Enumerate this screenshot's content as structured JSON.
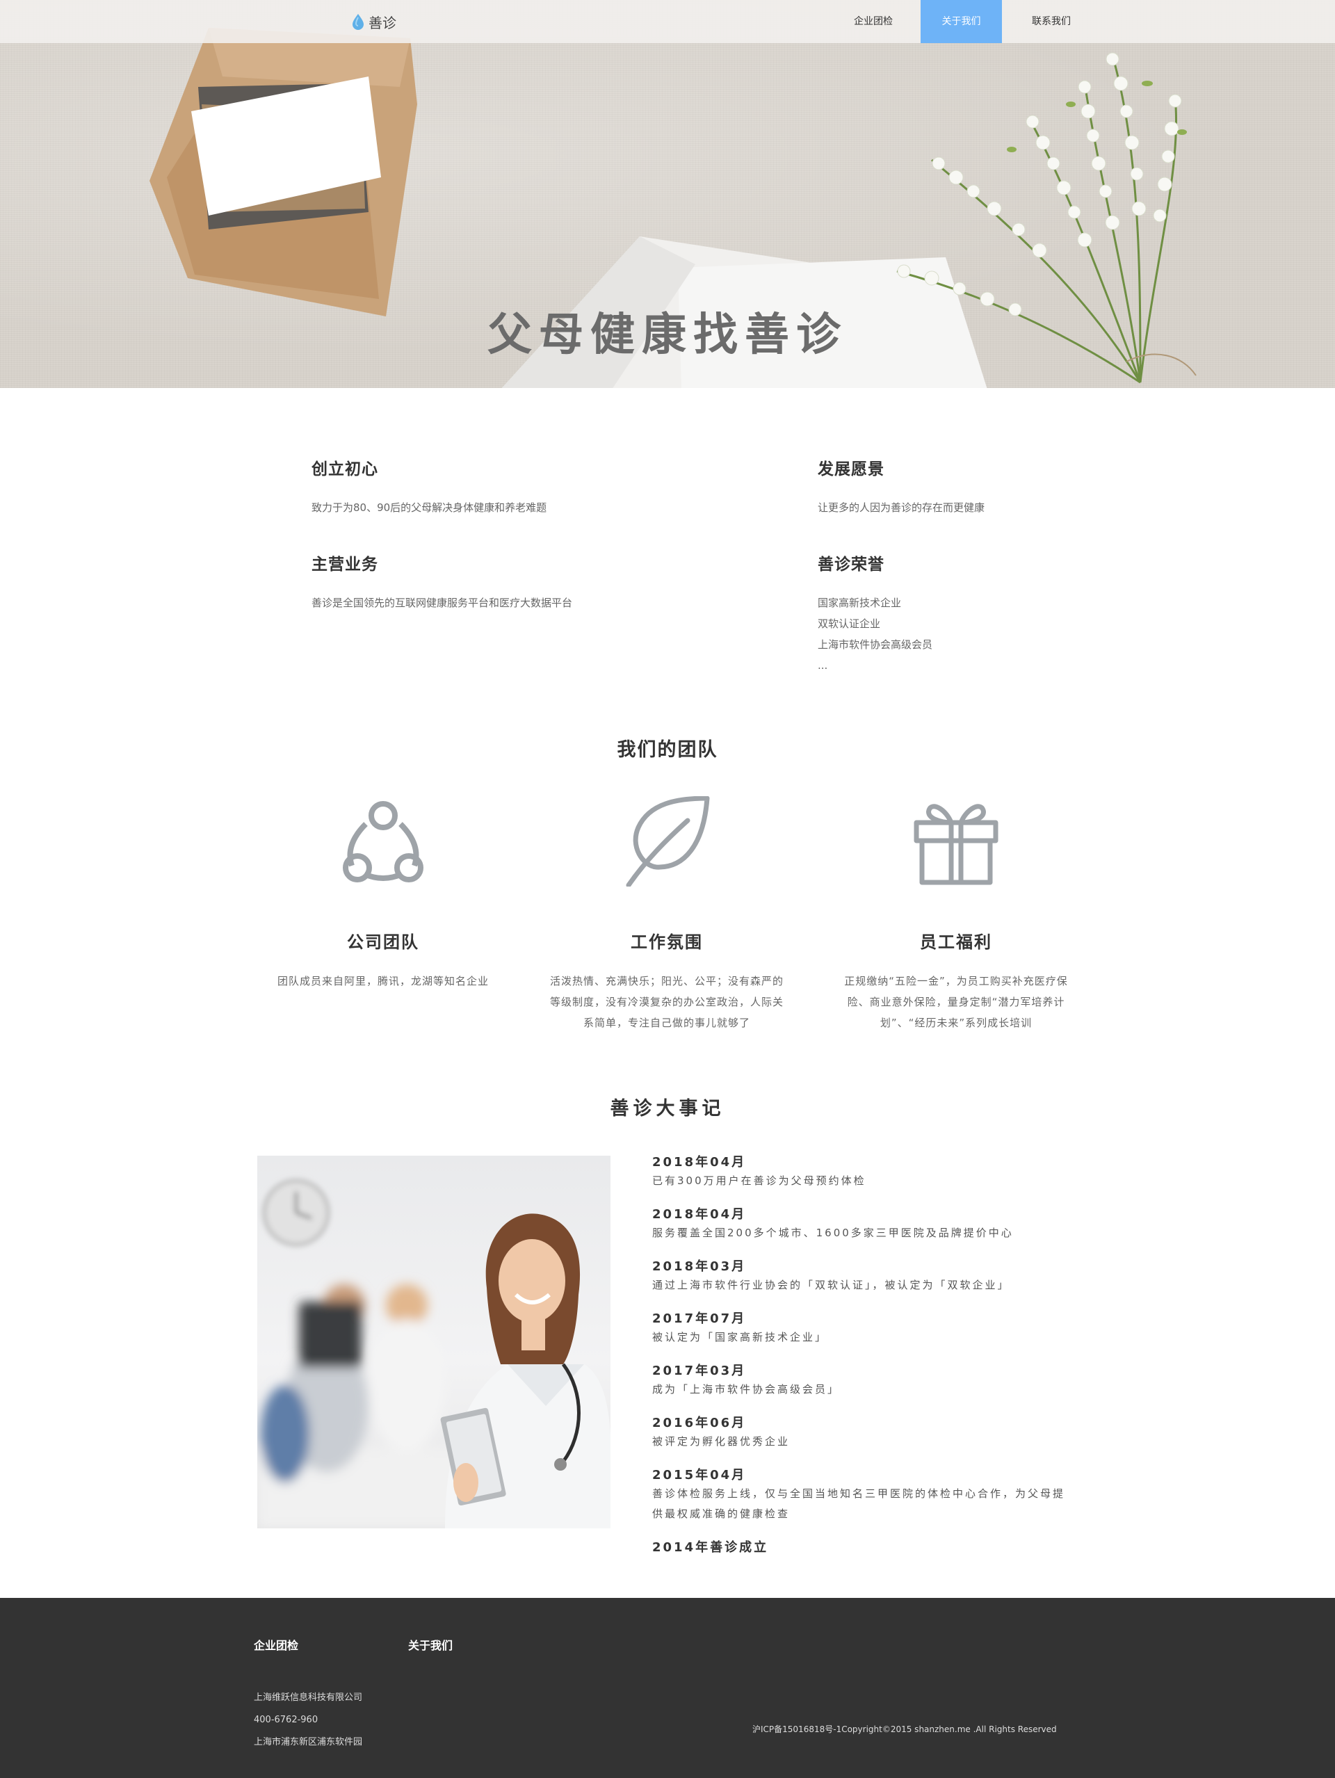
{
  "hero": {
    "title": "父母健康找善诊"
  },
  "nav": {
    "logo_text": "善诊",
    "items": [
      {
        "label": "企业团检",
        "active": false
      },
      {
        "label": "关于我们",
        "active": true
      },
      {
        "label": "联系我们",
        "active": false
      }
    ]
  },
  "about": {
    "blocks": [
      {
        "title": "创立初心",
        "lines": [
          "致力于为80、90后的父母解决身体健康和养老难题"
        ]
      },
      {
        "title": "发展愿景",
        "lines": [
          "让更多的人因为善诊的存在而更健康"
        ]
      },
      {
        "title": "主营业务",
        "lines": [
          "善诊是全国领先的互联网健康服务平台和医疗大数据平台"
        ]
      },
      {
        "title": "善诊荣誉",
        "lines": [
          "国家高新技术企业",
          "双软认证企业",
          "上海市软件协会高级会员",
          "..."
        ]
      }
    ]
  },
  "team": {
    "title": "我们的团队",
    "items": [
      {
        "icon": "network-icon",
        "name": "公司团队",
        "desc": "团队成员来自阿里，腾讯，龙湖等知名企业"
      },
      {
        "icon": "leaf-icon",
        "name": "工作氛围",
        "desc": "活泼热情、充满快乐；阳光、公平；没有森严的等级制度，没有冷漠复杂的办公室政治，人际关系简单，专注自己做的事儿就够了"
      },
      {
        "icon": "gift-icon",
        "name": "员工福利",
        "desc": "正规缴纳“五险一金”，为员工购买补充医疗保险、商业意外保险，量身定制“潜力军培养计划”、“经历未来”系列成长培训"
      }
    ]
  },
  "events": {
    "title": "善诊大事记",
    "items": [
      {
        "date": "2018年04月",
        "desc": "已有300万用户在善诊为父母预约体检"
      },
      {
        "date": "2018年04月",
        "desc": "服务覆盖全国200多个城市、1600多家三甲医院及品牌提价中心"
      },
      {
        "date": "2018年03月",
        "desc": "通过上海市软件行业协会的「双软认证」，被认定为「双软企业」"
      },
      {
        "date": "2017年07月",
        "desc": "被认定为「国家高新技术企业」"
      },
      {
        "date": "2017年03月",
        "desc": "成为「上海市软件协会高级会员」"
      },
      {
        "date": "2016年06月",
        "desc": "被评定为孵化器优秀企业"
      },
      {
        "date": "2015年04月",
        "desc": "善诊体检服务上线，仅与全国当地知名三甲医院的体检中心合作，为父母提供最权威准确的健康检查"
      },
      {
        "date": "2014年善诊成立",
        "desc": ""
      }
    ]
  },
  "footer": {
    "nav": [
      "企业团检",
      "关于我们"
    ],
    "company": "上海维跃信息科技有限公司",
    "phone": "400-6762-960",
    "address": "上海市浦东新区浦东软件园",
    "copyright": "沪ICP备15016818号-1Copyright©2015 shanzhen.me .All Rights Reserved"
  },
  "colors": {
    "accent": "#6eb3f7",
    "footer_bg": "#333333",
    "icon_gray": "#9ea3a8"
  }
}
